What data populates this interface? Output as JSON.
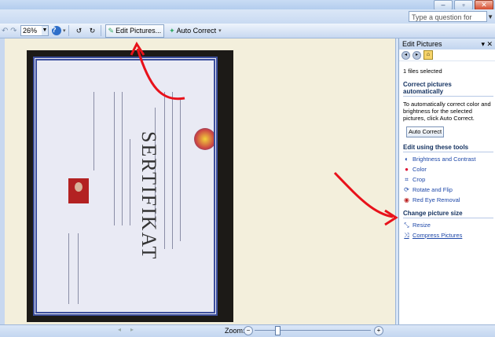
{
  "help_box": {
    "placeholder": "Type a question for help"
  },
  "toolbar": {
    "zoom_value": "26%",
    "edit_pictures_label": "Edit Pictures...",
    "auto_correct_label": "Auto Correct"
  },
  "status": {
    "zoom_label": "Zoom:"
  },
  "task_pane": {
    "title": "Edit Pictures",
    "files_selected": "1 files selected",
    "section_auto": "Correct pictures automatically",
    "auto_desc": "To automatically correct color and brightness for the selected pictures, click Auto Correct.",
    "auto_button": "Auto Correct",
    "section_tools": "Edit using these tools",
    "tools": [
      {
        "label": "Brightness and Contrast",
        "icon": "brightness-icon"
      },
      {
        "label": "Color",
        "icon": "color-icon"
      },
      {
        "label": "Crop",
        "icon": "crop-icon"
      },
      {
        "label": "Rotate and Flip",
        "icon": "rotate-icon"
      },
      {
        "label": "Red Eye Removal",
        "icon": "red-eye-icon"
      }
    ],
    "section_size": "Change picture size",
    "size_tools": [
      {
        "label": "Resize",
        "icon": "resize-icon"
      },
      {
        "label": "Compress Pictures",
        "icon": "compress-icon"
      }
    ]
  },
  "certificate": {
    "title": "SERTIFIKAT"
  },
  "colors": {
    "annotation_arrow": "#e8121b",
    "certificate_border": "#3d4f9d"
  }
}
